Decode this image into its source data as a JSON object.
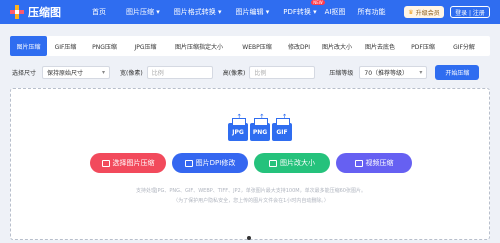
{
  "app": {
    "logo_text": "压缩图",
    "nav": [
      {
        "label": "首页"
      },
      {
        "label": "图片压缩 ▾"
      },
      {
        "label": "图片格式转换 ▾"
      },
      {
        "label": "图片编辑 ▾"
      },
      {
        "label": "PDF转换 ▾"
      },
      {
        "label": "AI抠图"
      },
      {
        "label": "所有功能"
      }
    ],
    "new_badge": "NEW",
    "vip_label": "升级会员",
    "login_label": "登录 | 注册",
    "colors": {
      "primary": "#2f6df0",
      "red": "#f24a5c",
      "green": "#25c27c",
      "purple": "#6660f2"
    }
  },
  "tabs": [
    {
      "label": "图片压缩"
    },
    {
      "label": "GIF压缩"
    },
    {
      "label": "PNG压缩"
    },
    {
      "label": "JPG压缩"
    },
    {
      "label": "图片压缩指定大小"
    },
    {
      "label": "WEBP压缩"
    },
    {
      "label": "修改DPI"
    },
    {
      "label": "图片改大小"
    },
    {
      "label": "图片去底色"
    },
    {
      "label": "PDF压缩"
    },
    {
      "label": "GIF分解"
    }
  ],
  "options": {
    "size_label": "选择尺寸",
    "size_value": "保持原始尺寸",
    "width_label": "宽(像素)",
    "width_placeholder": "比例",
    "height_label": "高(像素)",
    "height_placeholder": "比例",
    "level_label": "压缩等级",
    "level_value": "70（推荐等级）",
    "start_label": "开始压缩"
  },
  "drop": {
    "file_types": [
      "JPG",
      "PNG",
      "GIF"
    ],
    "actions": [
      {
        "label": "选择图片压缩",
        "icon": "image-icon"
      },
      {
        "label": "图片DPI修改",
        "icon": "monitor-icon"
      },
      {
        "label": "图片改大小",
        "icon": "resize-icon"
      },
      {
        "label": "视频压缩",
        "icon": "video-icon"
      }
    ],
    "note1": "支持处理JPG、PNG、GIF、WEBP、TIFF、JP2，单张图片最大支持100M，单次最多能压缩60张图片。",
    "note2": "（为了保护用户隐私安全，您上传的图片文件会在1小时内自动删除。）"
  }
}
